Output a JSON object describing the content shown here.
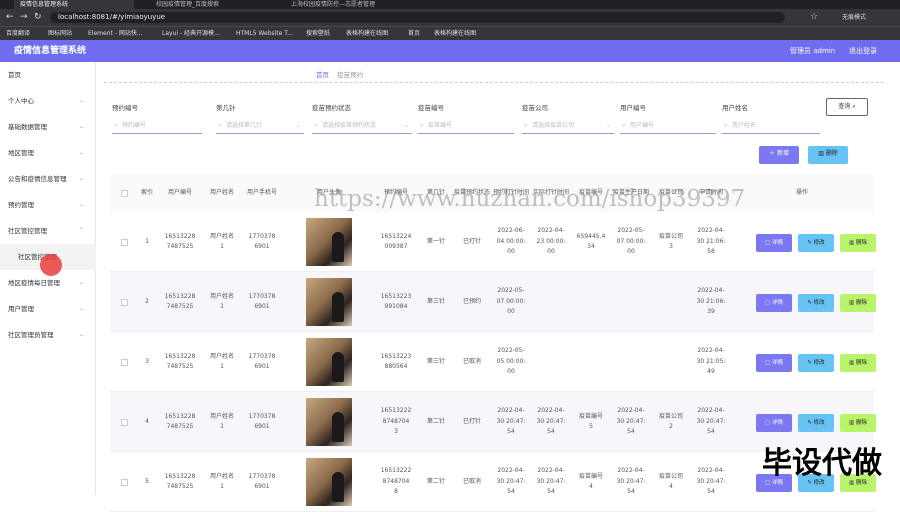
{
  "browser": {
    "tabs": [
      "疫情信息管理系统",
      "校园疫情管理_百度搜索",
      "上海校园疫情防控—志愿者管理"
    ],
    "url": "localhost:8081/#/yimiaoyuyue",
    "profile": "无痕模式",
    "bookmarks": [
      "百度翻译",
      "图标网站",
      "Element - 网站快...",
      "Layui - 经典开源模...",
      "HTML5 Website T...",
      "搜索壁纸",
      "表格构建在线图",
      "首页",
      "表格构建在线图"
    ]
  },
  "app": {
    "title": "疫情信息管理系统",
    "admin_label": "管理员 admin",
    "logout_label": "退出登录"
  },
  "sidebar": {
    "items": [
      {
        "label": "首页"
      },
      {
        "label": "个人中心"
      },
      {
        "label": "基础数据管理"
      },
      {
        "label": "地区管理"
      },
      {
        "label": "公告和疫情信息管理"
      },
      {
        "label": "预约管理"
      },
      {
        "label": "社区管控管理"
      },
      {
        "label": "社区管控管理"
      },
      {
        "label": "地区疫情每日管理"
      },
      {
        "label": "用户管理"
      },
      {
        "label": "社区管理员管理"
      }
    ]
  },
  "breadcrumb": {
    "home": "首页",
    "current": "疫苗预约"
  },
  "filters": [
    {
      "label": "预约编号",
      "placeholder": "预约编号"
    },
    {
      "label": "第几针",
      "placeholder": "请选择第几针"
    },
    {
      "label": "疫苗预约状态",
      "placeholder": "请选择疫苗预约状态"
    },
    {
      "label": "疫苗编号",
      "placeholder": "疫苗编号"
    },
    {
      "label": "疫苗公司",
      "placeholder": "请选择疫苗公司"
    },
    {
      "label": "用户编号",
      "placeholder": "用户编号"
    },
    {
      "label": "用户姓名",
      "placeholder": "用户姓名"
    }
  ],
  "buttons": {
    "query": "查询",
    "add": "新增",
    "delete": "删除"
  },
  "table": {
    "columns": [
      "索引",
      "用户编号",
      "用户姓名",
      "用户手机号",
      "用户头像",
      "预约编号",
      "第几针",
      "疫苗预约状态",
      "预约打针时间",
      "实际打针时间",
      "疫苗编号",
      "疫苗生产日期",
      "疫苗公司",
      "申请时间",
      "操作"
    ],
    "row_actions": {
      "detail": "详情",
      "edit": "修改",
      "remove": "删除"
    },
    "rows": [
      {
        "idx": "1",
        "user_no": "16513228\n7487525",
        "user_name": "用户姓名\n1",
        "phone": "1770378\n6901",
        "appt_no": "16513224\n009387",
        "dose": "第一针",
        "status": "已打针",
        "appt_time": "2022-06-\n04 00:00:\n00",
        "actual_time": "2022-04-\n23 00:00:\n00",
        "vac_no": "659445.4\n34",
        "prod_date": "2022-05-\n07 00:00:\n00",
        "company": "疫苗公司\n3",
        "apply_time": "2022-04-\n30 21:06:\n58"
      },
      {
        "idx": "2",
        "user_no": "16513228\n7487525",
        "user_name": "用户姓名\n1",
        "phone": "1770378\n6901",
        "appt_no": "16513223\n991084",
        "dose": "第三针",
        "status": "已预约",
        "appt_time": "2022-05-\n07 00:00:\n00",
        "actual_time": "",
        "vac_no": "",
        "prod_date": "",
        "company": "",
        "apply_time": "2022-04-\n30 21:06:\n39"
      },
      {
        "idx": "3",
        "user_no": "16513228\n7487525",
        "user_name": "用户姓名\n1",
        "phone": "1770378\n6901",
        "appt_no": "16513223\n880564",
        "dose": "第三针",
        "status": "已取消",
        "appt_time": "2022-05-\n05 00:00:\n00",
        "actual_time": "",
        "vac_no": "",
        "prod_date": "",
        "company": "",
        "apply_time": "2022-04-\n30 21:05:\n49"
      },
      {
        "idx": "4",
        "user_no": "16513228\n7487525",
        "user_name": "用户姓名\n1",
        "phone": "1770378\n6901",
        "appt_no": "16513222\n8748704\n3",
        "dose": "第二针",
        "status": "已打针",
        "appt_time": "2022-04-\n30 20:47:\n54",
        "actual_time": "2022-04-\n30 20:47:\n54",
        "vac_no": "疫苗编号\n5",
        "prod_date": "2022-04-\n30 20:47:\n54",
        "company": "疫苗公司\n2",
        "apply_time": "2022-04-\n30 20:47:\n54"
      },
      {
        "idx": "5",
        "user_no": "16513228\n7487525",
        "user_name": "用户姓名\n1",
        "phone": "1770378\n6901",
        "appt_no": "16513222\n8748704\n8",
        "dose": "第二针",
        "status": "已取消",
        "appt_time": "2022-04-\n30 20:47:\n54",
        "actual_time": "2022-04-\n30 20:47:\n54",
        "vac_no": "疫苗编号\n4",
        "prod_date": "2022-04-\n30 20:47:\n54",
        "company": "疫苗公司\n4",
        "apply_time": "2022-04-\n30 20:47:\n54"
      }
    ]
  },
  "watermark": "https://www.huzhan.com/ishop39397",
  "overlay_text": "毕设代做",
  "colors": {
    "primary": "#6f6cf0",
    "info": "#67c3f3",
    "success": "#b8f36a"
  }
}
